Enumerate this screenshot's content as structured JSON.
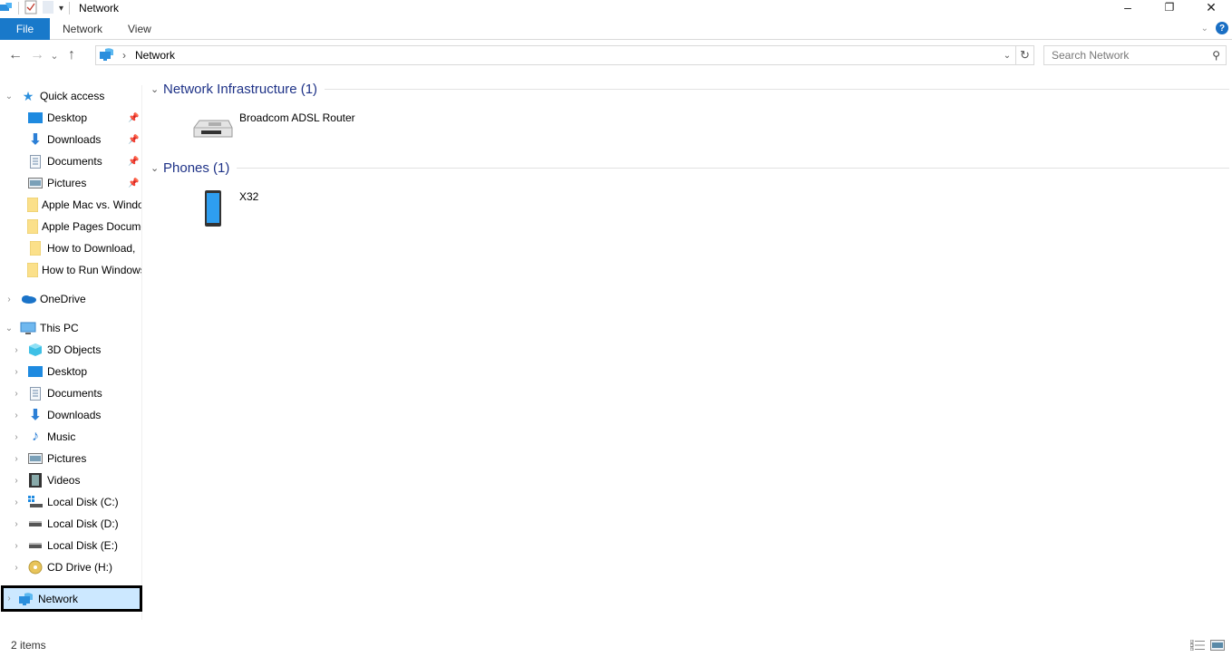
{
  "window": {
    "title": "Network",
    "controls": {
      "minimize": "–",
      "maximize": "❐",
      "close": "✕"
    }
  },
  "ribbon": {
    "tabs": [
      {
        "label": "File"
      },
      {
        "label": "Network"
      },
      {
        "label": "View"
      }
    ],
    "help": "?"
  },
  "nav": {
    "back": "←",
    "forward": "→",
    "recent": "⌄",
    "up": "↑",
    "address": {
      "crumb": "Network",
      "separator": "›"
    },
    "refresh": "↻",
    "search_placeholder": "Search Network"
  },
  "sidebar": {
    "quick_access": {
      "label": "Quick access",
      "items": [
        {
          "label": "Desktop",
          "icon": "desktop-icon",
          "pinned": true
        },
        {
          "label": "Downloads",
          "icon": "downloads-icon",
          "pinned": true
        },
        {
          "label": "Documents",
          "icon": "documents-icon",
          "pinned": true
        },
        {
          "label": "Pictures",
          "icon": "pictures-icon",
          "pinned": true
        },
        {
          "label": "Apple Mac vs. Windows",
          "icon": "folder-icon",
          "pinned": false
        },
        {
          "label": "Apple Pages Documents",
          "icon": "folder-icon",
          "pinned": false
        },
        {
          "label": "How to Download,",
          "icon": "folder-icon",
          "pinned": false
        },
        {
          "label": "How to Run Windows",
          "icon": "folder-icon",
          "pinned": false
        }
      ]
    },
    "onedrive": {
      "label": "OneDrive"
    },
    "this_pc": {
      "label": "This PC",
      "items": [
        {
          "label": "3D Objects",
          "icon": "3d-objects-icon"
        },
        {
          "label": "Desktop",
          "icon": "desktop-icon"
        },
        {
          "label": "Documents",
          "icon": "documents-icon"
        },
        {
          "label": "Downloads",
          "icon": "downloads-icon"
        },
        {
          "label": "Music",
          "icon": "music-icon"
        },
        {
          "label": "Pictures",
          "icon": "pictures-icon"
        },
        {
          "label": "Videos",
          "icon": "videos-icon"
        },
        {
          "label": "Local Disk (C:)",
          "icon": "system-drive-icon"
        },
        {
          "label": "Local Disk (D:)",
          "icon": "drive-icon"
        },
        {
          "label": "Local Disk (E:)",
          "icon": "drive-icon"
        },
        {
          "label": "CD Drive (H:)",
          "icon": "cd-drive-icon"
        }
      ]
    },
    "network": {
      "label": "Network",
      "selected": true
    }
  },
  "content": {
    "groups": [
      {
        "title": "Network Infrastructure (1)",
        "items": [
          {
            "label": "Broadcom ADSL Router",
            "icon": "router-icon"
          }
        ]
      },
      {
        "title": "Phones (1)",
        "items": [
          {
            "label": "X32",
            "icon": "phone-icon"
          }
        ]
      }
    ]
  },
  "status": {
    "items_count": "2 items"
  }
}
